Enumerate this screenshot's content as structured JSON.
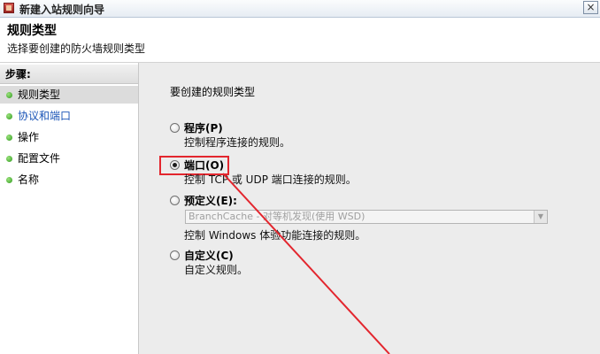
{
  "window": {
    "title": "新建入站规则向导",
    "close_label": "×"
  },
  "header": {
    "title": "规则类型",
    "subtitle": "选择要创建的防火墙规则类型"
  },
  "steps": {
    "title": "步骤:",
    "items": [
      {
        "label": "规则类型",
        "active": true
      },
      {
        "label": "协议和端口",
        "link": true
      },
      {
        "label": "操作"
      },
      {
        "label": "配置文件"
      },
      {
        "label": "名称"
      }
    ]
  },
  "main": {
    "prompt": "要创建的规则类型",
    "options": [
      {
        "label": "程序(P)",
        "description": "控制程序连接的规则。",
        "checked": false
      },
      {
        "label": "端口(O)",
        "description": "控制 TCP 或 UDP 端口连接的规则。",
        "checked": true
      },
      {
        "label": "预定义(E):",
        "description": "控制 Windows 体验功能连接的规则。",
        "checked": false
      },
      {
        "label": "自定义(C)",
        "description": "自定义规则。",
        "checked": false
      }
    ],
    "predefined_select": {
      "value": "BranchCache - 对等机发现(使用 WSD)",
      "arrow": "▼"
    }
  },
  "colors": {
    "annotation": "#e3262e",
    "link": "#1b55b7",
    "step_dot": "#2f9a1f"
  }
}
